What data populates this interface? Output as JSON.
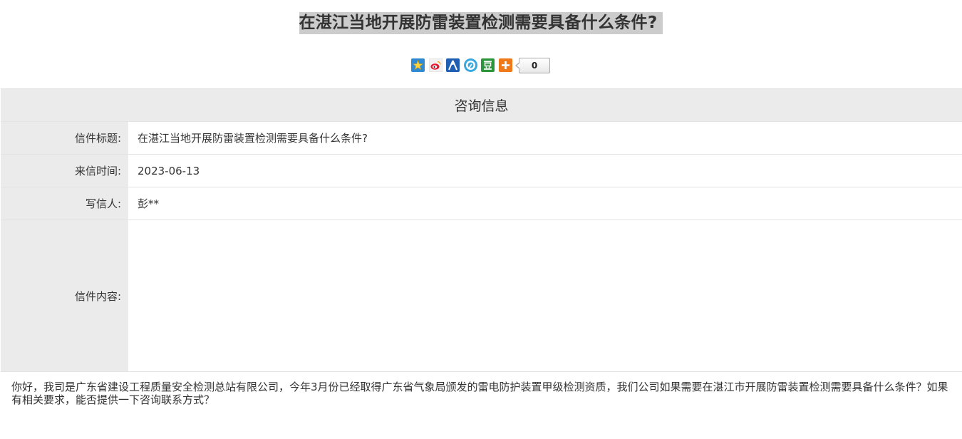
{
  "page_title": "在湛江当地开展防雷装置检测需要具备什么条件?",
  "share": {
    "icons": [
      "qzone-icon",
      "weibo-icon",
      "renren-icon",
      "tencent-weibo-icon",
      "douban-icon",
      "more-icon"
    ],
    "count": "0"
  },
  "section_title": "咨询信息",
  "fields": {
    "subject_label": "信件标题:",
    "subject_value": "在湛江当地开展防雷装置检测需要具备什么条件?",
    "date_label": "来信时间:",
    "date_value": "2023-06-13",
    "author_label": "写信人:",
    "author_value": "彭**",
    "content_label": "信件内容:"
  },
  "content": "你好，我司是广东省建设工程质量安全检测总站有限公司，今年3月份已经取得广东省气象局颁发的雷电防护装置甲级检测资质，我们公司如果需要在湛江市开展防雷装置检测需要具备什么条件？如果有相关要求，能否提供一下咨询联系方式？",
  "colors": {
    "title_bg": "#cccccc",
    "label_bg": "#ebebeb",
    "border": "#e3e3e3",
    "text": "#333333"
  }
}
